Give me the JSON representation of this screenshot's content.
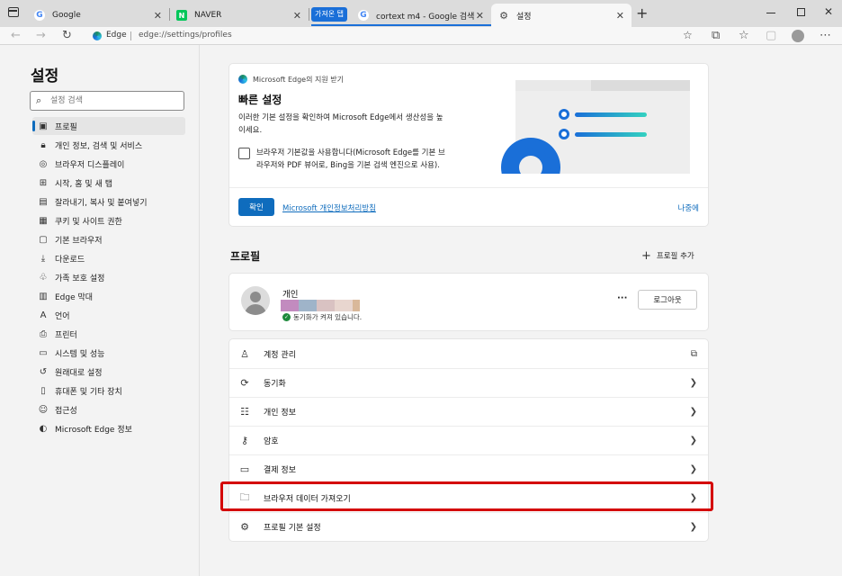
{
  "tabs": [
    {
      "title": "Google"
    },
    {
      "title": "NAVER"
    },
    {
      "group_label": "가져온 탭",
      "title": "cortext m4 - Google 검색"
    },
    {
      "title": "설정"
    }
  ],
  "address": {
    "site_label": "Edge",
    "url": "edge://settings/profiles"
  },
  "sidebar": {
    "title": "설정",
    "search_placeholder": "설정 검색",
    "items": [
      {
        "label": "프로필"
      },
      {
        "label": "개인 정보, 검색 및 서비스"
      },
      {
        "label": "브라우저 디스플레이"
      },
      {
        "label": "시작, 홈 및 새 탭"
      },
      {
        "label": "잘라내기, 복사 및 붙여넣기"
      },
      {
        "label": "쿠키 및 사이트 권한"
      },
      {
        "label": "기본 브라우저"
      },
      {
        "label": "다운로드"
      },
      {
        "label": "가족 보호 설정"
      },
      {
        "label": "Edge 막대"
      },
      {
        "label": "언어"
      },
      {
        "label": "프린터"
      },
      {
        "label": "시스템 및 성능"
      },
      {
        "label": "원래대로 설정"
      },
      {
        "label": "휴대폰 및 기타 장치"
      },
      {
        "label": "접근성"
      },
      {
        "label": "Microsoft Edge 정보"
      }
    ]
  },
  "quick": {
    "header": "Microsoft Edge의 지원 받기",
    "title": "빠른 설정",
    "desc_line1": "이러한 기본 설정을 확인하여 Microsoft Edge에서 생산성을 높",
    "desc_line2": "이세요.",
    "checkbox_line1": "브라우저 기본값을 사용합니다(Microsoft Edge를 기본 브",
    "checkbox_line2": "라우저와 PDF 뷰어로, Bing을 기본 검색 엔진으로 사용).",
    "confirm_label": "확인",
    "privacy_link": "Microsoft 개인정보처리방침",
    "later_label": "나중에"
  },
  "profiles": {
    "heading": "프로필",
    "add_label": "프로필 추가",
    "name": "개인",
    "sync_status": "동기화가 켜져 있습니다.",
    "more_label": "···",
    "signout_label": "로그아웃",
    "swatch_colors": [
      "#c28bbf",
      "#9fb4c9",
      "#d9c2c2",
      "#e8d6cf",
      "#d9b89a"
    ]
  },
  "rows": [
    {
      "label": "계정 관리"
    },
    {
      "label": "동기화"
    },
    {
      "label": "개인 정보"
    },
    {
      "label": "암호"
    },
    {
      "label": "결제 정보"
    },
    {
      "label": "브라우저 데이터 가져오기"
    },
    {
      "label": "프로필 기본 설정"
    }
  ],
  "colors": {
    "accent": "#0f6cbd",
    "highlight_border": "#d40000",
    "illustration_blue": "#1a6fd8",
    "illustration_teal": "#33d1c0"
  }
}
